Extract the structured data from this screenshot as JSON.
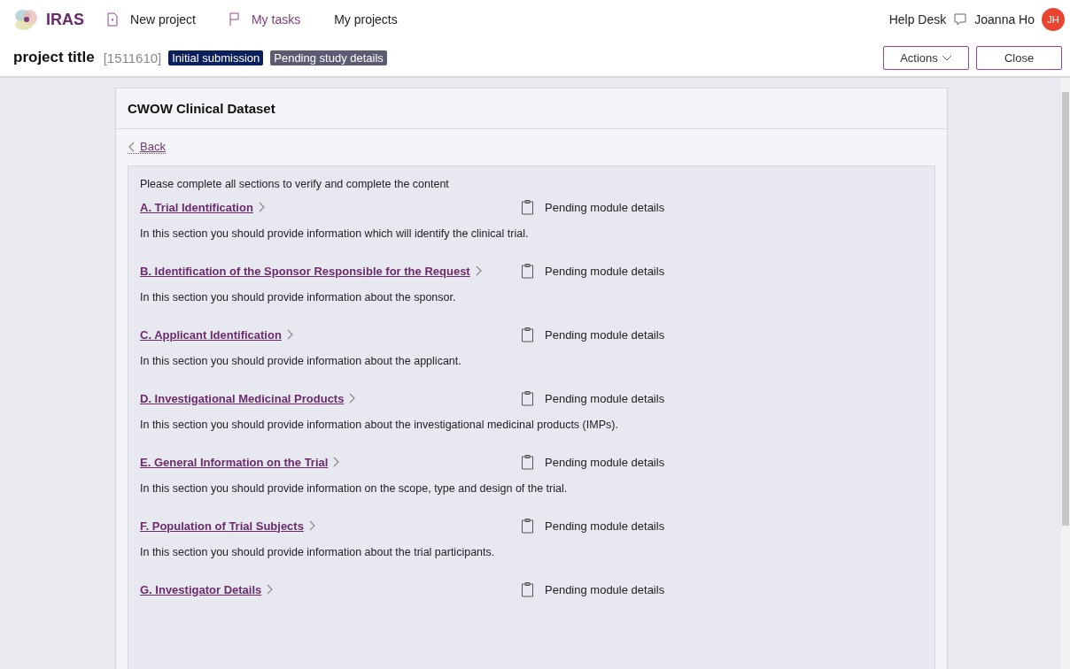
{
  "nav": {
    "brand": "IRAS",
    "links": [
      {
        "label": "New project",
        "kind": "new",
        "selected": false
      },
      {
        "label": "My tasks",
        "kind": "tasks",
        "selected": true
      },
      {
        "label": "My projects",
        "kind": "projects",
        "selected": false
      }
    ],
    "help": "Help Desk",
    "user": {
      "name": "Joanna Ho",
      "initials": "JH"
    }
  },
  "project": {
    "title": "project title",
    "id": "[1511610]",
    "badges": [
      {
        "label": "Initial submission",
        "color": "#0b1f5c"
      },
      {
        "label": "Pending study details",
        "color": "#5b5b72"
      }
    ],
    "buttons": [
      {
        "label": "Actions",
        "kind": "dropdown"
      },
      {
        "label": "Close",
        "kind": "plain"
      }
    ]
  },
  "card": {
    "title": "CWOW Clinical Dataset",
    "back": "Back",
    "intro": "Please complete all sections to verify and complete the content",
    "sections": [
      {
        "title": "A. Trial Identification",
        "status": "Pending module details",
        "description": "In this section you should provide information which will identify the clinical trial."
      },
      {
        "title": "B. Identification of the Sponsor Responsible for the Request",
        "status": "Pending module details",
        "description": "In this section you should provide information about the sponsor."
      },
      {
        "title": "C. Applicant Identification",
        "status": "Pending module details",
        "description": "In this section you should provide information about the applicant."
      },
      {
        "title": "D. Investigational Medicinal Products",
        "status": "Pending module details",
        "description": "In this section you should provide information about the investigational medicinal products (IMPs)."
      },
      {
        "title": "E. General Information on the Trial",
        "status": "Pending module details",
        "description": "In this section you should provide information on the scope, type and design of the trial."
      },
      {
        "title": "F. Population of Trial Subjects",
        "status": "Pending module details",
        "description": "In this section you should provide information about the trial participants."
      },
      {
        "title": "G. Investigator Details",
        "status": "Pending module details"
      }
    ]
  }
}
